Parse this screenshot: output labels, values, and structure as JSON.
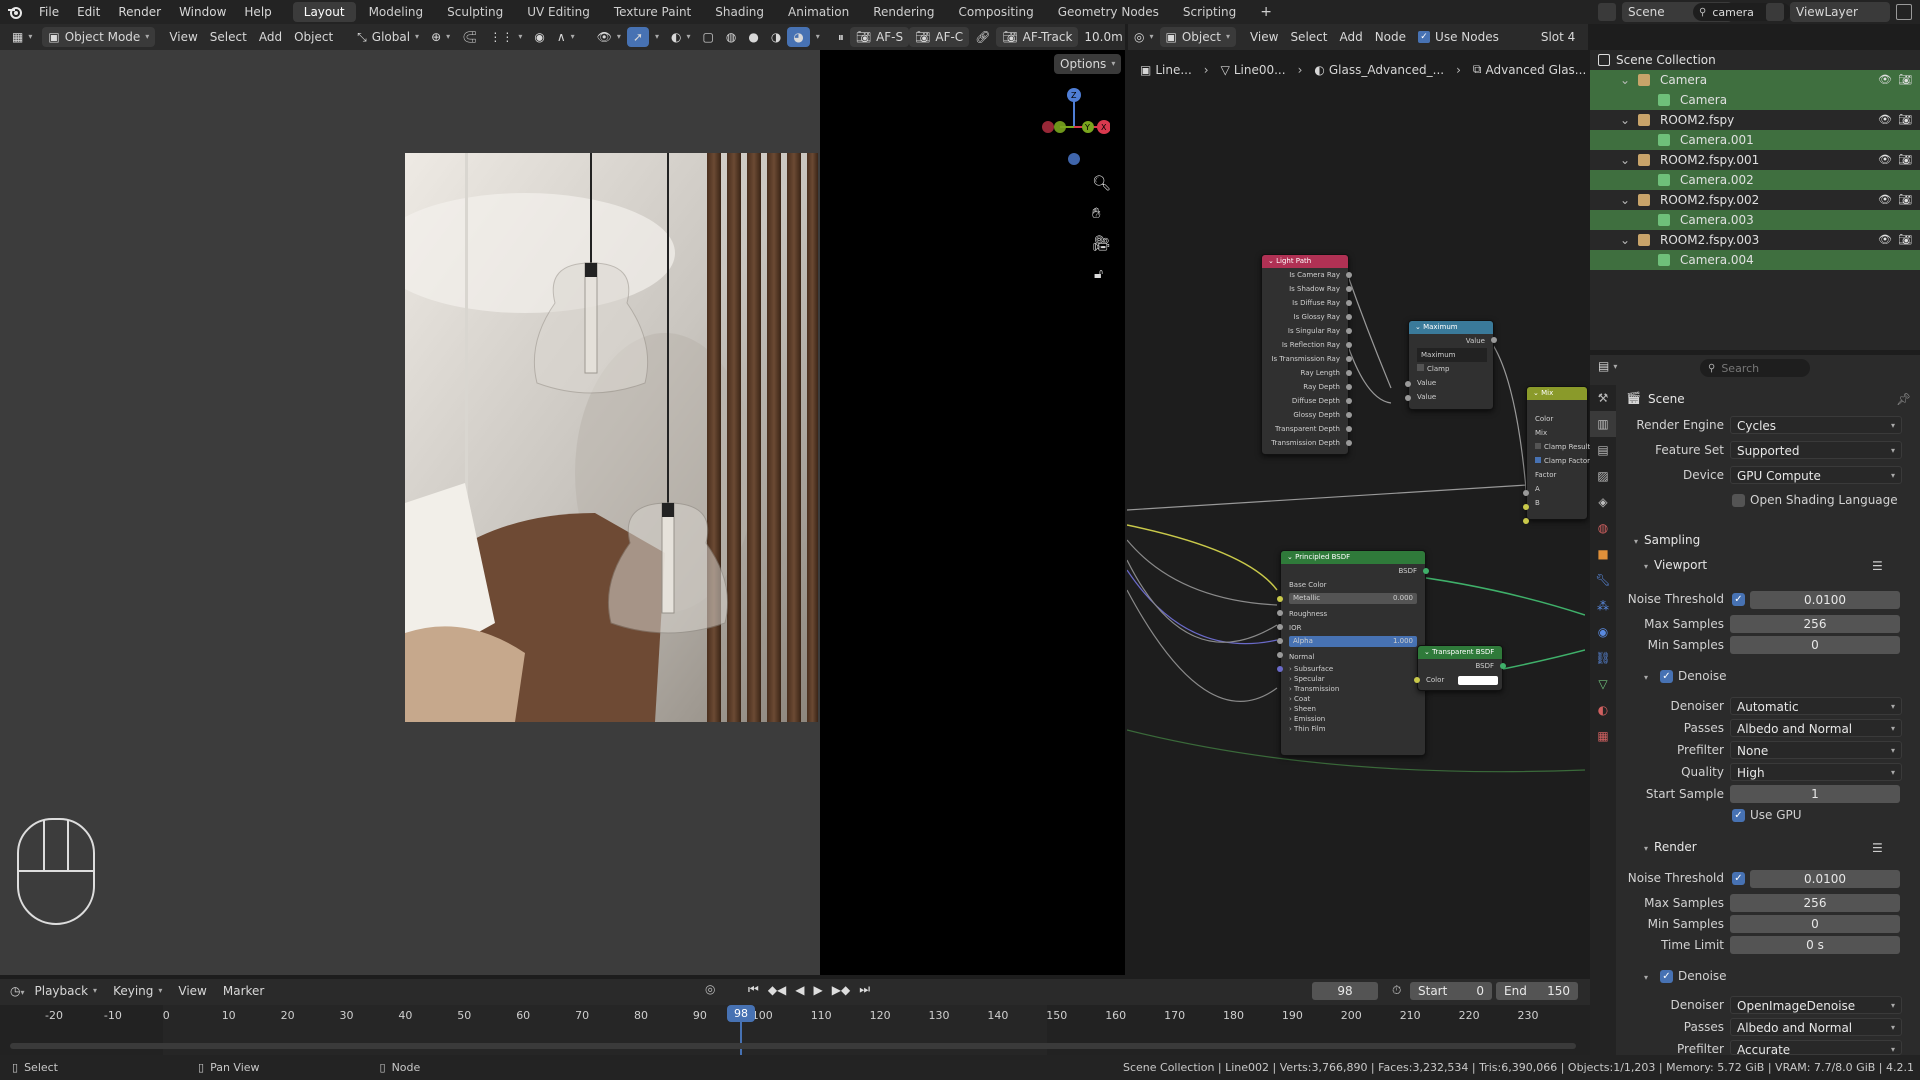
{
  "topbar": {
    "menus": [
      "File",
      "Edit",
      "Render",
      "Window",
      "Help"
    ],
    "workspaces": [
      "Layout",
      "Modeling",
      "Sculpting",
      "UV Editing",
      "Texture Paint",
      "Shading",
      "Animation",
      "Rendering",
      "Compositing",
      "Geometry Nodes",
      "Scripting"
    ],
    "active_workspace": "Layout",
    "scene_name": "Scene",
    "search_value": "camera",
    "view_layer": "ViewLayer"
  },
  "viewport_header": {
    "mode": "Object Mode",
    "menus": [
      "View",
      "Select",
      "Add",
      "Object"
    ],
    "orientation": "Global",
    "af_s": "AF-S",
    "af_c": "AF-C",
    "af_track": "AF-Track",
    "focal": "10.0m",
    "options_label": "Options"
  },
  "node_header": {
    "object_label": "Object",
    "menus": [
      "View",
      "Select",
      "Add",
      "Node"
    ],
    "use_nodes_label": "Use Nodes",
    "slot": "Slot 4",
    "breadcrumb": [
      "Line...",
      "Line00...",
      "Glass_Advanced_...",
      "Advanced Glas..."
    ]
  },
  "nodes": {
    "light_path": {
      "title": "Light Path",
      "outputs": [
        "Is Camera Ray",
        "Is Shadow Ray",
        "Is Diffuse Ray",
        "Is Glossy Ray",
        "Is Singular Ray",
        "Is Reflection Ray",
        "Is Transmission Ray",
        "Ray Length",
        "Ray Depth",
        "Diffuse Depth",
        "Glossy Depth",
        "Transparent Depth",
        "Transmission Depth"
      ]
    },
    "maximum": {
      "title": "Maximum",
      "output": "Value",
      "operation": "Maximum",
      "clamp": "Clamp",
      "inputs": [
        "Value",
        "Value"
      ]
    },
    "mix": {
      "title": "Mix",
      "type": "Color",
      "blend": "Mix",
      "clamp_result": "Clamp Result",
      "clamp_factor": "Clamp Factor",
      "factor": "Factor",
      "a": "A",
      "b": "B"
    },
    "principled": {
      "title": "Principled BSDF",
      "output": "BSDF",
      "base_color": "Base Color",
      "metallic_label": "Metallic",
      "metallic_value": "0.000",
      "roughness": "Roughness",
      "ior": "IOR",
      "alpha_label": "Alpha",
      "alpha_value": "1.000",
      "normal": "Normal",
      "panels": [
        "Subsurface",
        "Specular",
        "Transmission",
        "Coat",
        "Sheen",
        "Emission",
        "Thin Film"
      ]
    },
    "transparent": {
      "title": "Transparent BSDF",
      "output": "BSDF",
      "color": "Color"
    }
  },
  "outliner": {
    "root": "Scene Collection",
    "rows": [
      {
        "label": "Camera",
        "level": 1,
        "type": "collection"
      },
      {
        "label": "Camera",
        "level": 2,
        "type": "camera"
      },
      {
        "label": "ROOM2.fspy",
        "level": 1,
        "type": "collection"
      },
      {
        "label": "Camera.001",
        "level": 2,
        "type": "camera"
      },
      {
        "label": "ROOM2.fspy.001",
        "level": 1,
        "type": "collection"
      },
      {
        "label": "Camera.002",
        "level": 2,
        "type": "camera"
      },
      {
        "label": "ROOM2.fspy.002",
        "level": 1,
        "type": "collection"
      },
      {
        "label": "Camera.003",
        "level": 2,
        "type": "camera"
      },
      {
        "label": "ROOM2.fspy.003",
        "level": 1,
        "type": "collection"
      },
      {
        "label": "Camera.004",
        "level": 2,
        "type": "camera"
      }
    ]
  },
  "properties": {
    "search_placeholder": "Search",
    "context": "Scene",
    "render_engine_label": "Render Engine",
    "render_engine": "Cycles",
    "feature_set_label": "Feature Set",
    "feature_set": "Supported",
    "device_label": "Device",
    "device": "GPU Compute",
    "osl_label": "Open Shading Language",
    "sampling": "Sampling",
    "viewport": {
      "title": "Viewport",
      "noise_threshold_label": "Noise Threshold",
      "noise_threshold": "0.0100",
      "max_samples_label": "Max Samples",
      "max_samples": "256",
      "min_samples_label": "Min Samples",
      "min_samples": "0",
      "denoise": "Denoise",
      "denoiser_label": "Denoiser",
      "denoiser": "Automatic",
      "passes_label": "Passes",
      "passes": "Albedo and Normal",
      "prefilter_label": "Prefilter",
      "prefilter": "None",
      "quality_label": "Quality",
      "quality": "High",
      "start_sample_label": "Start Sample",
      "start_sample": "1",
      "use_gpu": "Use GPU"
    },
    "render": {
      "title": "Render",
      "noise_threshold_label": "Noise Threshold",
      "noise_threshold": "0.0100",
      "max_samples_label": "Max Samples",
      "max_samples": "256",
      "min_samples_label": "Min Samples",
      "min_samples": "0",
      "time_limit_label": "Time Limit",
      "time_limit": "0 s",
      "denoise": "Denoise",
      "denoiser_label": "Denoiser",
      "denoiser": "OpenImageDenoise",
      "passes_label": "Passes",
      "passes": "Albedo and Normal",
      "prefilter_label": "Prefilter",
      "prefilter": "Accurate"
    }
  },
  "timeline": {
    "menus": [
      "Playback",
      "Keying",
      "View",
      "Marker"
    ],
    "current_frame": "98",
    "start_label": "Start",
    "start": "0",
    "end_label": "End",
    "end": "150",
    "ticks": [
      "-20",
      "-10",
      "0",
      "10",
      "20",
      "30",
      "40",
      "50",
      "60",
      "70",
      "80",
      "90",
      "100",
      "110",
      "120",
      "130",
      "140",
      "150",
      "160",
      "170",
      "180",
      "190",
      "200",
      "210",
      "220",
      "230"
    ],
    "playhead_label": "98"
  },
  "statusbar": {
    "select": "Select",
    "pan_view": "Pan View",
    "node": "Node",
    "stats": "Scene Collection | Line002 | Verts:3,766,890 | Faces:3,232,534 | Tris:6,390,066 | Objects:1/1,203 | Memory: 5.72 GiB | VRAM: 7.7/8.0 GiB | 4.2.1"
  },
  "colors": {
    "accent_blue": "#4772b3",
    "selection_green": "#3f6f3f",
    "node_light_path": "#b03154",
    "node_maximum": "#3a7a9a",
    "node_mix": "#8a9a2a",
    "node_shader": "#2f7a3a"
  }
}
